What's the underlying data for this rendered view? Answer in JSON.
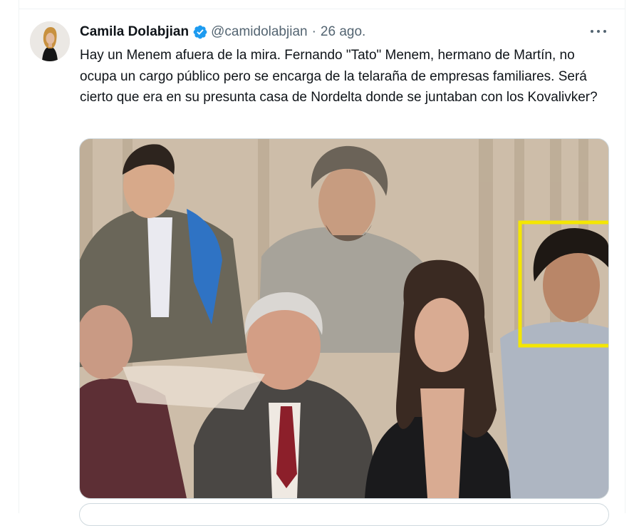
{
  "tweet": {
    "author_name": "Camila Dolabjian",
    "handle": "@camidolabjian",
    "separator": "·",
    "date": "26 ago.",
    "text": "Hay un Menem afuera de la mira. Fernando \"Tato\" Menem, hermano de Martín, no ocupa un cargo público pero se encarga de la telaraña de empresas familiares. Será cierto que era en su presunta casa de Nordelta donde se juntaban con los Kovalivker?",
    "verified": true
  },
  "colors": {
    "verified_blue": "#1d9bf0",
    "secondary_text": "#536471",
    "highlight_box": "#f4e600"
  },
  "icons": {
    "verified": "verified-badge-icon",
    "more": "more-options-icon"
  }
}
